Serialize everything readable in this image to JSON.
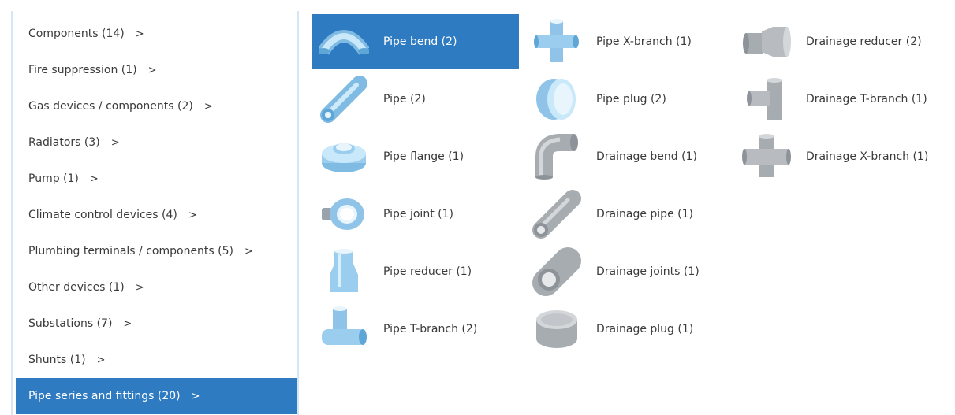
{
  "categories": [
    {
      "label": "Components (14)",
      "arrow": ">"
    },
    {
      "label": "Fire suppression (1)",
      "arrow": ">"
    },
    {
      "label": "Gas devices / components (2)",
      "arrow": ">"
    },
    {
      "label": "Radiators (3)",
      "arrow": ">"
    },
    {
      "label": "Pump (1)",
      "arrow": ">"
    },
    {
      "label": "Climate control devices (4)",
      "arrow": ">"
    },
    {
      "label": "Plumbing terminals / components (5)",
      "arrow": ">"
    },
    {
      "label": "Other devices (1)",
      "arrow": ">"
    },
    {
      "label": "Substations (7)",
      "arrow": ">"
    },
    {
      "label": "Shunts (1)",
      "arrow": ">"
    },
    {
      "label": "Pipe series and fittings (20)",
      "arrow": ">",
      "selected": true
    }
  ],
  "items": [
    {
      "label": "Pipe bend (2)",
      "icon": "pipe-bend-icon",
      "selected": true
    },
    {
      "label": "Pipe (2)",
      "icon": "pipe-icon"
    },
    {
      "label": "Pipe flange (1)",
      "icon": "pipe-flange-icon"
    },
    {
      "label": "Pipe joint (1)",
      "icon": "pipe-joint-icon"
    },
    {
      "label": "Pipe reducer (1)",
      "icon": "pipe-reducer-icon"
    },
    {
      "label": "Pipe T-branch (2)",
      "icon": "pipe-t-branch-icon"
    },
    {
      "label": "Pipe X-branch (1)",
      "icon": "pipe-x-branch-icon"
    },
    {
      "label": "Pipe plug (2)",
      "icon": "pipe-plug-icon"
    },
    {
      "label": "Drainage bend (1)",
      "icon": "drainage-bend-icon"
    },
    {
      "label": "Drainage pipe (1)",
      "icon": "drainage-pipe-icon"
    },
    {
      "label": "Drainage joints (1)",
      "icon": "drainage-joints-icon"
    },
    {
      "label": "Drainage plug (1)",
      "icon": "drainage-plug-icon"
    },
    {
      "label": "Drainage reducer (2)",
      "icon": "drainage-reducer-icon"
    },
    {
      "label": "Drainage T-branch (1)",
      "icon": "drainage-t-branch-icon"
    },
    {
      "label": "Drainage X-branch (1)",
      "icon": "drainage-x-branch-icon"
    }
  ],
  "colors": {
    "selected": "#2f7bc1",
    "pipe_blue": "#a9d6f2",
    "drain_gray": "#b8bcc0",
    "divider": "#d6e6f4"
  }
}
